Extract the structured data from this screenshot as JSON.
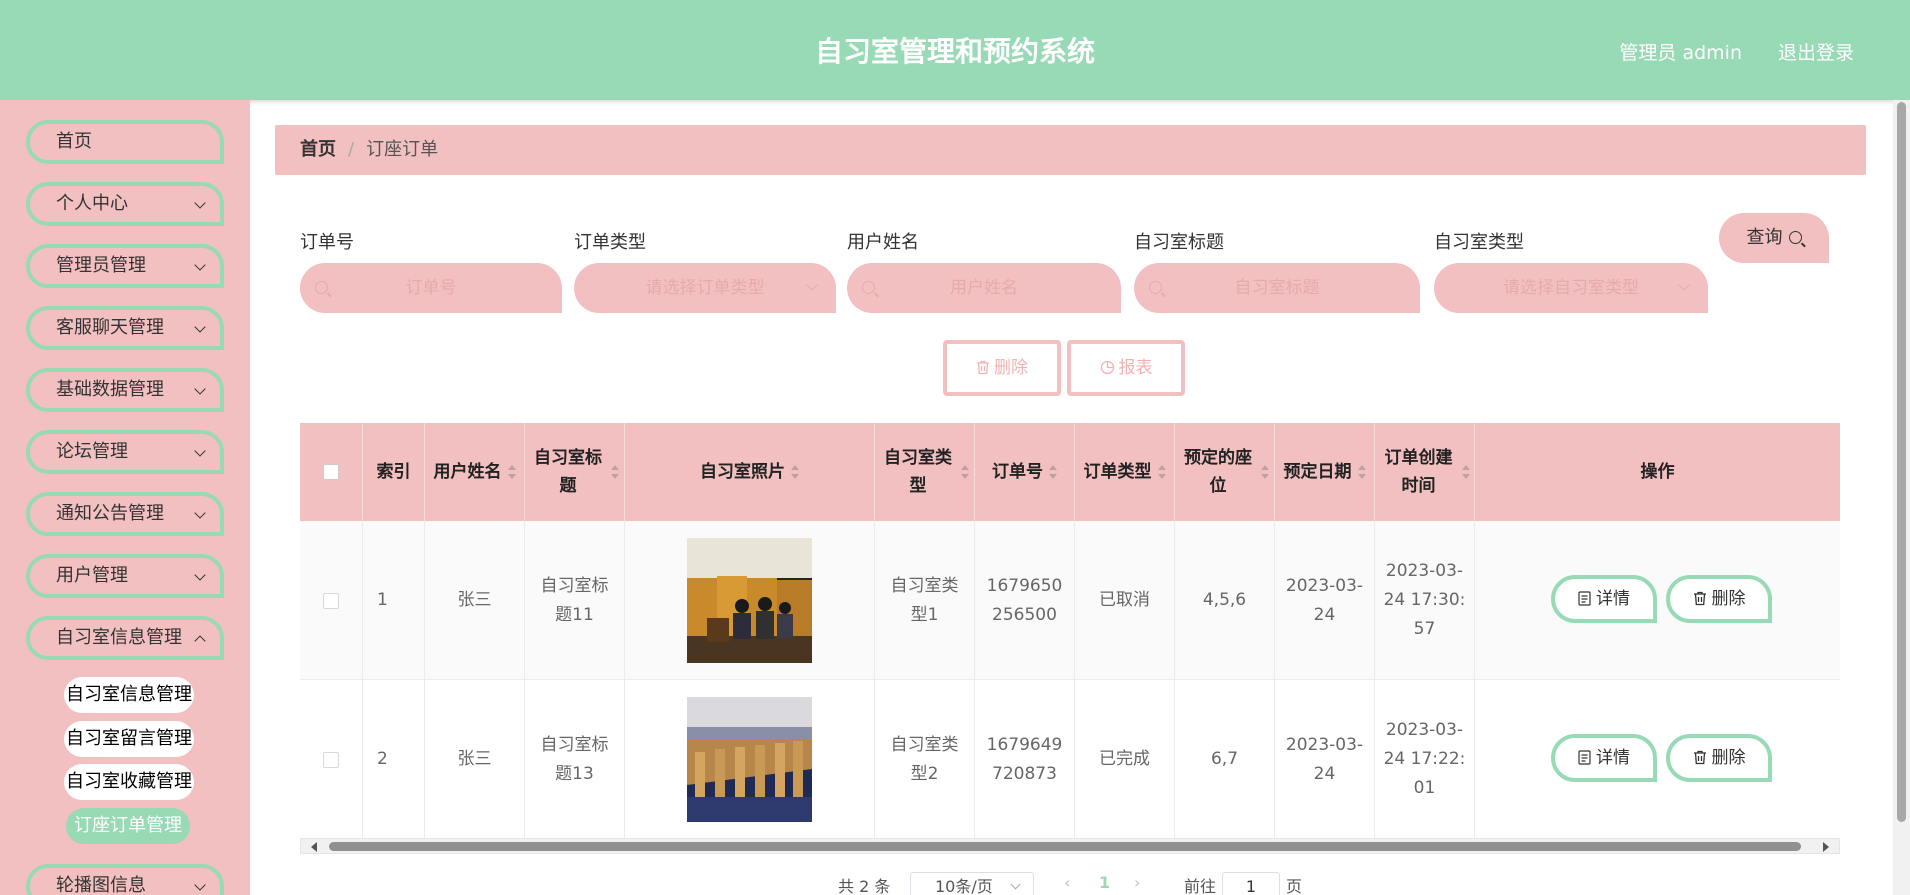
{
  "header": {
    "title": "自习室管理和预约系统",
    "user": "管理员 admin",
    "logout": "退出登录"
  },
  "sidebar": {
    "items": [
      {
        "label": "首页"
      },
      {
        "label": "个人中心"
      },
      {
        "label": "管理员管理"
      },
      {
        "label": "客服聊天管理"
      },
      {
        "label": "基础数据管理"
      },
      {
        "label": "论坛管理"
      },
      {
        "label": "通知公告管理"
      },
      {
        "label": "用户管理"
      },
      {
        "label": "自习室信息管理"
      },
      {
        "label": "轮播图信息"
      }
    ],
    "subitems": [
      {
        "label": "自习室信息管理"
      },
      {
        "label": "自习室留言管理"
      },
      {
        "label": "自习室收藏管理"
      },
      {
        "label": "订座订单管理"
      }
    ]
  },
  "breadcrumb": {
    "home": "首页",
    "sep": "/",
    "current": "订座订单"
  },
  "filters": {
    "order_no": {
      "label": "订单号",
      "placeholder": "订单号"
    },
    "order_type": {
      "label": "订单类型",
      "placeholder": "请选择订单类型"
    },
    "user_name": {
      "label": "用户姓名",
      "placeholder": "用户姓名"
    },
    "room_title": {
      "label": "自习室标题",
      "placeholder": "自习室标题"
    },
    "room_type": {
      "label": "自习室类型",
      "placeholder": "请选择自习室类型"
    },
    "query": "查询"
  },
  "actions": {
    "delete": "删除",
    "report": "报表"
  },
  "table": {
    "headers": [
      "索引",
      "用户姓名",
      "自习室标题",
      "自习室照片",
      "自习室类型",
      "订单号",
      "订单类型",
      "预定的座位",
      "预定日期",
      "订单创建时间",
      "操作"
    ],
    "rows": [
      {
        "index": "1",
        "user": "张三",
        "title": "自习室标题11",
        "type": "自习室类型1",
        "order_no": "1679650256500",
        "order_type": "已取消",
        "seats": "4,5,6",
        "date": "2023-03-24",
        "created": "2023-03-24 17:30:57"
      },
      {
        "index": "2",
        "user": "张三",
        "title": "自习室标题13",
        "type": "自习室类型2",
        "order_no": "1679649720873",
        "order_type": "已完成",
        "seats": "6,7",
        "date": "2023-03-24",
        "created": "2023-03-24 17:22:01"
      }
    ],
    "row_actions": {
      "detail": "详情",
      "delete": "删除"
    }
  },
  "pagination": {
    "total": "共 2 条",
    "page_size": "10条/页",
    "current": "1",
    "goto_prefix": "前往",
    "goto_value": "1",
    "goto_suffix": "页"
  },
  "colors": {
    "green": "#98d9b6",
    "pink": "#f2c0c1"
  }
}
